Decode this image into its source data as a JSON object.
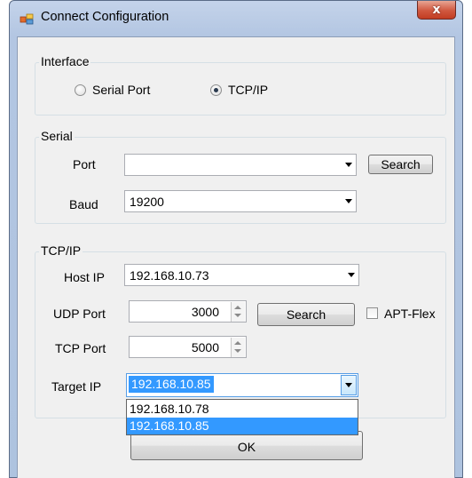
{
  "window": {
    "title": "Connect Configuration",
    "close_label": "x"
  },
  "interface_group": {
    "legend": "Interface",
    "options": [
      {
        "label": "Serial Port",
        "checked": false
      },
      {
        "label": "TCP/IP",
        "checked": true
      }
    ]
  },
  "serial_group": {
    "legend": "Serial",
    "port_label": "Port",
    "port_value": "",
    "search_label": "Search",
    "baud_label": "Baud",
    "baud_value": "19200"
  },
  "tcpip_group": {
    "legend": "TCP/IP",
    "host_ip_label": "Host IP",
    "host_ip_value": "192.168.10.73",
    "udp_port_label": "UDP Port",
    "udp_port_value": "3000",
    "search_label": "Search",
    "apt_flex_label": "APT-Flex",
    "apt_flex_checked": false,
    "tcp_port_label": "TCP Port",
    "tcp_port_value": "5000",
    "target_ip_label": "Target IP",
    "target_ip_value": "192.168.10.85",
    "target_ip_options": [
      "192.168.10.78",
      "192.168.10.85"
    ],
    "selected_option": "192.168.10.85"
  },
  "ok_label": "OK",
  "colors": {
    "selection": "#3399ff",
    "dialog_bg": "#f0f0f0",
    "title_bar": "#b9cbe6",
    "close_button": "#c74a32"
  }
}
